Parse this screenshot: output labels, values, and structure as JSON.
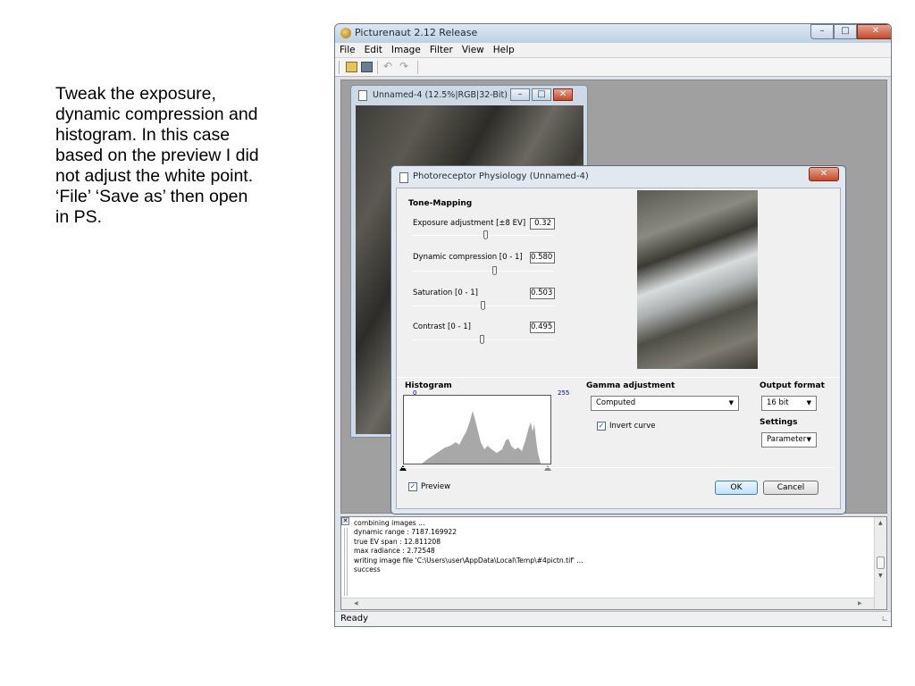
{
  "caption": "Tweak the exposure,\ndynamic compression and\nhistogram.  In this case\nbased on the preview I did\nnot adjust the white point.\n‘File’ ‘Save as’ then open\nin PS.",
  "app": {
    "title": "Picturenaut 2.12 Release",
    "menu": [
      "File",
      "Edit",
      "Image",
      "Filter",
      "View",
      "Help"
    ]
  },
  "document": {
    "title": "Unnamed-4 (12.5%|RGB|32-Bit) *"
  },
  "dialog": {
    "title": "Photoreceptor Physiology (Unnamed-4)",
    "tone_mapping_label": "Tone-Mapping",
    "sliders": [
      {
        "label": "Exposure adjustment [±8 EV]",
        "value": "0.32",
        "position": 0.52
      },
      {
        "label": "Dynamic compression [0 - 1]",
        "value": "0.580",
        "position": 0.58
      },
      {
        "label": "Saturation [0 - 1]",
        "value": "0.503",
        "position": 0.5
      },
      {
        "label": "Contrast [0 - 1]",
        "value": "0.495",
        "position": 0.495
      }
    ],
    "histogram": {
      "label": "Histogram",
      "min": "0",
      "max": "255"
    },
    "gamma": {
      "label": "Gamma adjustment",
      "selected": "Computed",
      "invert_label": "Invert curve",
      "invert_checked": true
    },
    "output": {
      "label": "Output format",
      "selected": "16 bit"
    },
    "settings": {
      "label": "Settings",
      "selected": "Parameter"
    },
    "preview": {
      "label": "Preview",
      "checked": true
    },
    "ok_label": "OK",
    "cancel_label": "Cancel"
  },
  "log": {
    "lines": [
      "combining images ...",
      "dynamic range : 7187.169922",
      "true EV span  : 12.811208",
      "max radiance  : 2.72548",
      "writing image file 'C:\\Users\\user\\AppData\\Local\\Temp\\#4pictn.tif' ...",
      "success"
    ]
  },
  "status": "Ready"
}
